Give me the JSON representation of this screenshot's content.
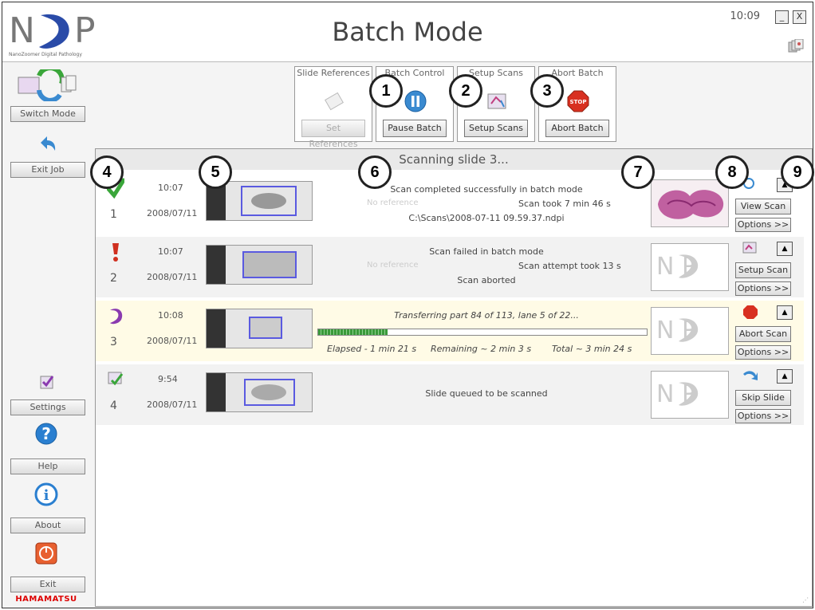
{
  "window": {
    "title": "Batch Mode",
    "clock": "10:09",
    "minimize_glyph": "_",
    "close_glyph": "X",
    "logo_letters": {
      "n": "N",
      "p": "P"
    },
    "logo_subtitle": "NanoZoomer Digital Pathology"
  },
  "sidebar": {
    "switch_mode": "Switch Mode",
    "exit_job": "Exit Job",
    "settings": "Settings",
    "help": "Help",
    "about": "About",
    "exit": "Exit",
    "brand": "HAMAMATSU"
  },
  "toolbar": {
    "groups": [
      {
        "label": "Slide References",
        "button": "Set References",
        "enabled": false
      },
      {
        "label": "Batch Control",
        "button": "Pause Batch",
        "enabled": true
      },
      {
        "label": "Setup Scans",
        "button": "Setup Scans",
        "enabled": true
      },
      {
        "label": "Abort Batch",
        "button": "Abort Batch",
        "enabled": true
      }
    ]
  },
  "status": {
    "heading": "Scanning slide 3..."
  },
  "slides": [
    {
      "number": "1",
      "time": "10:07",
      "date": "2008/07/11",
      "state": "success",
      "state_icon": "check-icon",
      "message": "Scan completed successfully in batch mode",
      "reference": "No reference",
      "duration": "Scan took 7 min 46 s",
      "path": "C:\\Scans\\2008-07-11 09.59.37.ndpi",
      "action": "View Scan",
      "options": "Options >>"
    },
    {
      "number": "2",
      "time": "10:07",
      "date": "2008/07/11",
      "state": "failed",
      "state_icon": "exclamation-icon",
      "message": "Scan failed in batch mode",
      "reference": "No reference",
      "duration": "Scan attempt took 13 s",
      "detail": "Scan aborted",
      "action": "Setup Scan",
      "options": "Options >>"
    },
    {
      "number": "3",
      "time": "10:08",
      "date": "2008/07/11",
      "state": "scanning",
      "state_icon": "scanning-icon",
      "message": "Transferring part 84 of 113, lane 5 of 22...",
      "progress": 0.21,
      "elapsed": "Elapsed - 1 min 21 s",
      "remaining": "Remaining ~ 2 min 3 s",
      "total": "Total ~ 3 min 24 s",
      "action": "Abort Scan",
      "options": "Options >>"
    },
    {
      "number": "4",
      "time": "9:54",
      "date": "2008/07/11",
      "state": "queued",
      "state_icon": "queued-icon",
      "message": "Slide queued to be scanned",
      "action": "Skip Slide",
      "options": "Options >>"
    }
  ],
  "callouts": [
    "1",
    "2",
    "3",
    "4",
    "5",
    "6",
    "7",
    "8",
    "9"
  ],
  "colors": {
    "success": "#3aa63a",
    "failed": "#d03020",
    "scanning": "#8a3ab0",
    "progress": "#3a9a3a",
    "brand": "#dd0000"
  }
}
